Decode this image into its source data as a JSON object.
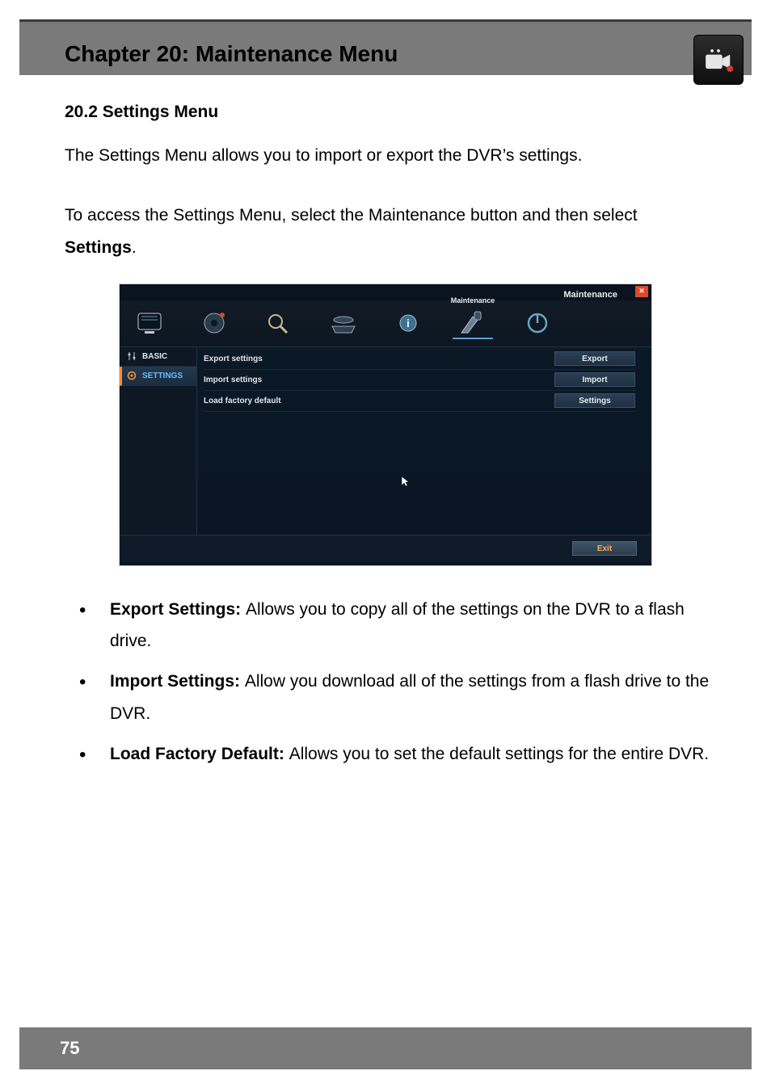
{
  "chapter": {
    "title": "Chapter 20: Maintenance Menu"
  },
  "section": {
    "heading": "20.2 Settings Menu",
    "p1": "The Settings Menu allows you to import or export the DVR’s settings.",
    "p2a": "To access the Settings Menu, select the Maintenance button and then select ",
    "p2b": "Settings",
    "p2c": "."
  },
  "screenshot": {
    "title": "Maintenance",
    "close": "✕",
    "sidebar": {
      "basic": "BASIC",
      "settings": "SETTINGS"
    },
    "rows": [
      {
        "label": "Export settings",
        "button": "Export"
      },
      {
        "label": "Import settings",
        "button": "Import"
      },
      {
        "label": "Load factory default",
        "button": "Settings"
      }
    ],
    "exit": "Exit",
    "topicons": {
      "selected_label": "Maintenance"
    }
  },
  "bullets": [
    {
      "term": "Export Settings: ",
      "desc": "Allows you to copy all of the settings on the DVR to a flash drive."
    },
    {
      "term": "Import Settings: ",
      "desc": "Allow you download all of the settings from a flash drive to the DVR."
    },
    {
      "term": "Load Factory Default: ",
      "desc": "Allows you to set the default settings for the entire DVR."
    }
  ],
  "footer": {
    "page": "75"
  }
}
